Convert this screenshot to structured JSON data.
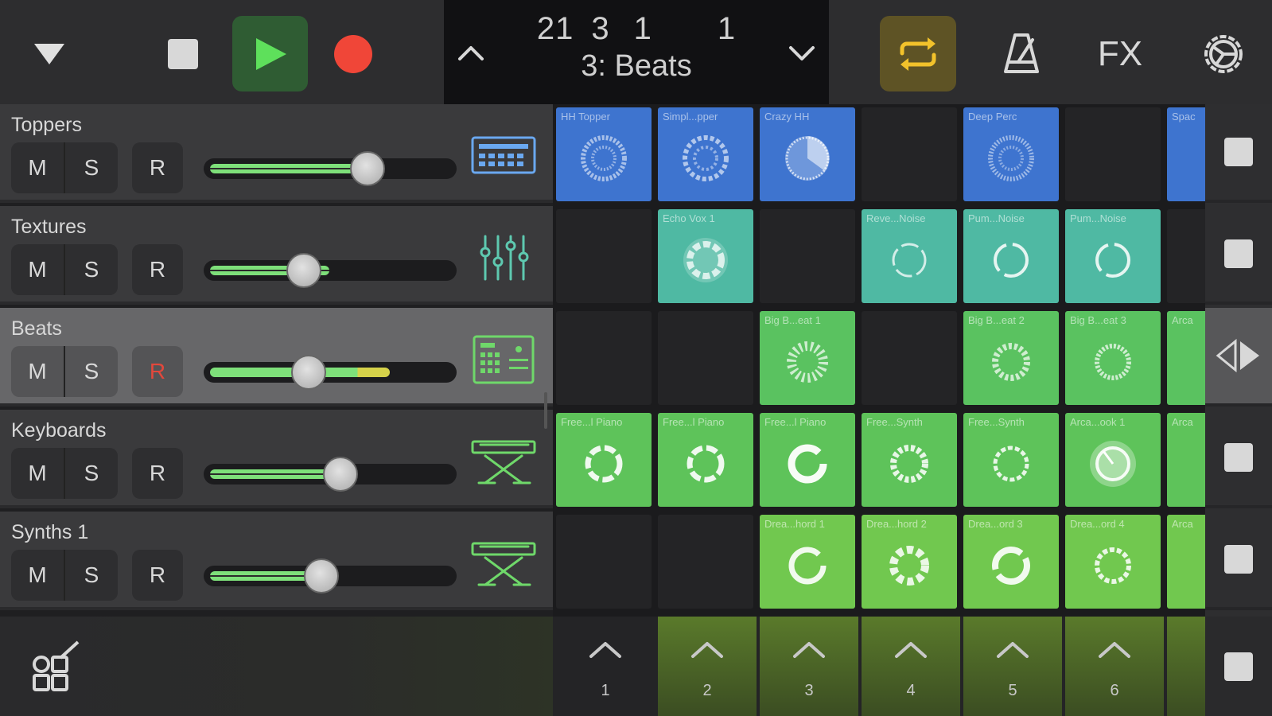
{
  "transport": {
    "menu_icon": "triangle-down-icon",
    "stop_icon": "stop-icon",
    "play_icon": "play-icon",
    "record_icon": "record-icon"
  },
  "lcd": {
    "bar": "21",
    "beat": "3",
    "division": "1",
    "tick": "1",
    "track": "3: Beats"
  },
  "controls": {
    "fx_label": "FX",
    "loop_color": "#f2c22b"
  },
  "colors": {
    "accent_green": "#7ee07a",
    "blue": "#3e74cf",
    "teal": "#4fb9a3",
    "green": "#5ac260",
    "lime": "#71c84f",
    "record": "#f04638"
  },
  "tracks": [
    {
      "name": "Toppers",
      "mute": "M",
      "solo": "S",
      "rec": "R",
      "icon": "drum-machine-icon"
    },
    {
      "name": "Textures",
      "mute": "M",
      "solo": "S",
      "rec": "R",
      "icon": "mixer-sliders-icon"
    },
    {
      "name": "Beats",
      "mute": "M",
      "solo": "S",
      "rec": "R",
      "icon": "beat-sequencer-icon"
    },
    {
      "name": "Keyboards",
      "mute": "M",
      "solo": "S",
      "rec": "R",
      "icon": "keyboard-stand-icon"
    },
    {
      "name": "Synths 1",
      "mute": "M",
      "solo": "S",
      "rec": "R",
      "icon": "keyboard-stand-icon"
    }
  ],
  "cells": {
    "row0": [
      "HH Topper",
      "Simpl...pper",
      "Crazy HH",
      "",
      "Deep Perc",
      "",
      "Spac"
    ],
    "row1": [
      "",
      "Echo Vox 1",
      "",
      "Reve...Noise",
      "Pum...Noise",
      "Pum...Noise",
      ""
    ],
    "row2": [
      "",
      "",
      "Big B...eat 1",
      "",
      "Big B...eat 2",
      "Big B...eat 3",
      "Arca"
    ],
    "row3": [
      "Free...l Piano",
      "Free...l Piano",
      "Free...l Piano",
      "Free...Synth",
      "Free...Synth",
      "Arca...ook 1",
      "Arca"
    ],
    "row4": [
      "",
      "",
      "Drea...hord 1",
      "Drea...hord 2",
      "Drea...ord 3",
      "Drea...ord 4",
      "Arca"
    ]
  },
  "scenes": [
    "1",
    "2",
    "3",
    "4",
    "5",
    "6"
  ]
}
